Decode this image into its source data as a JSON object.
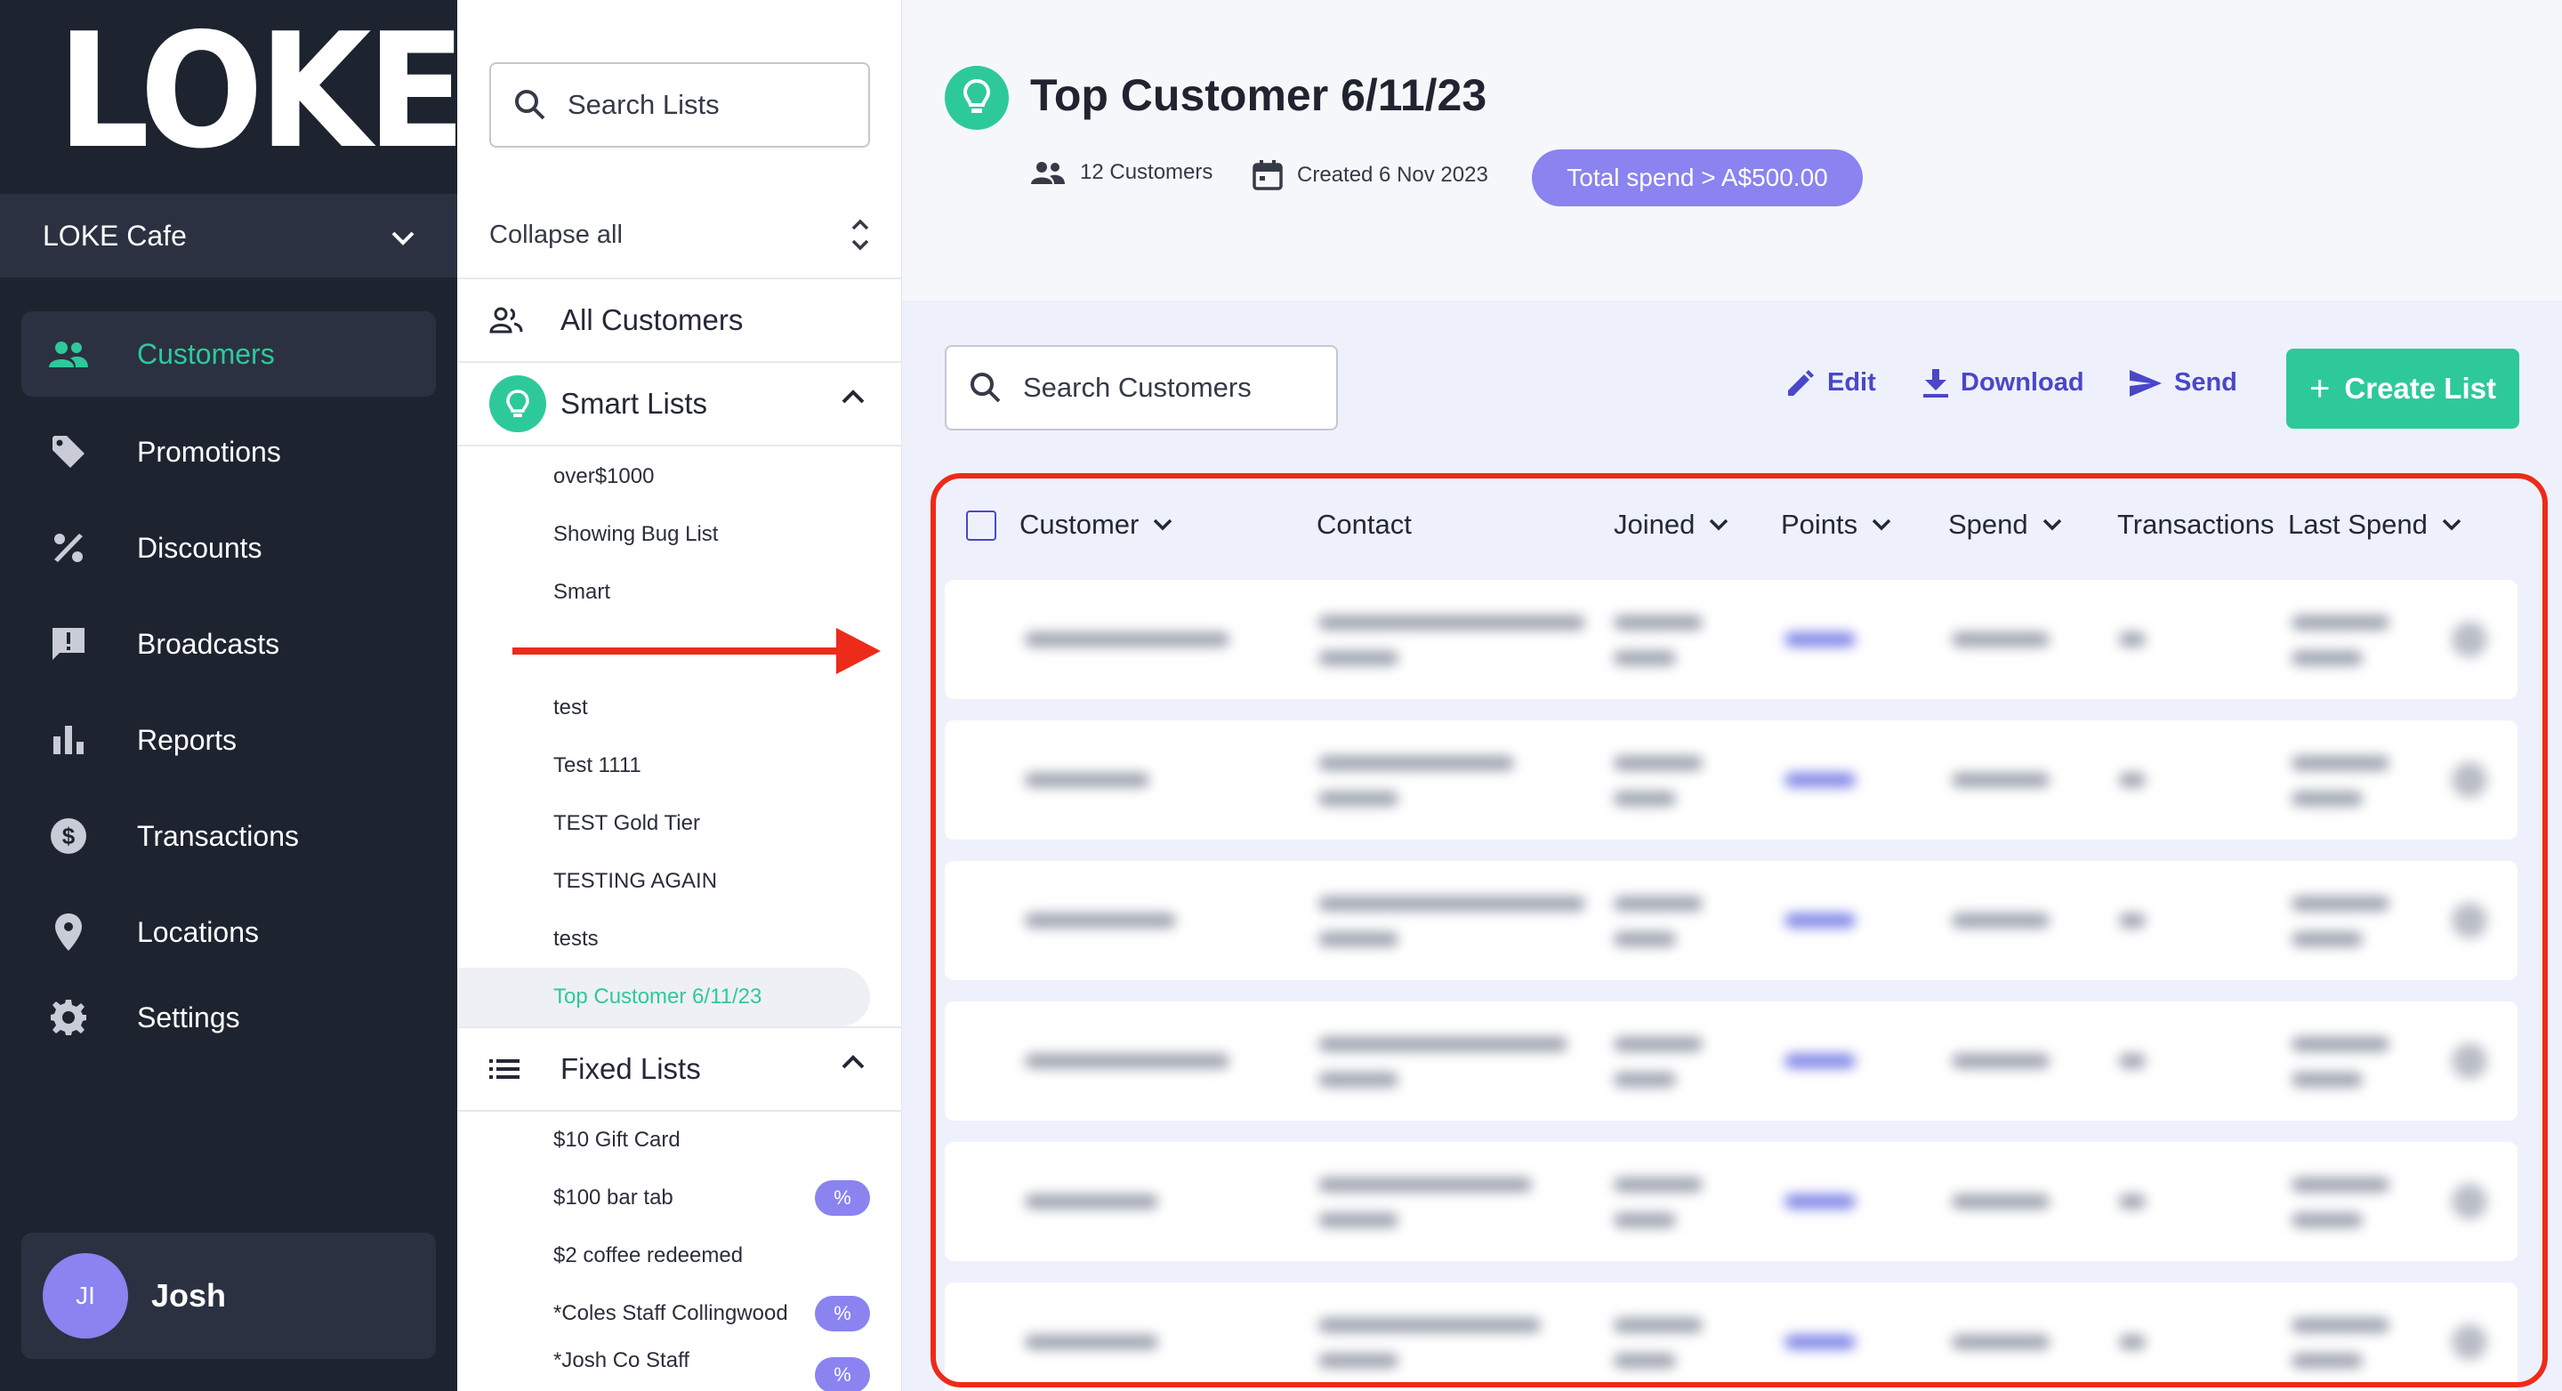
{
  "brand": {
    "logo": "LOKE",
    "venue": "LOKE Cafe"
  },
  "nav": {
    "items": [
      {
        "label": "Customers",
        "icon": "people-icon"
      },
      {
        "label": "Promotions",
        "icon": "tag-icon"
      },
      {
        "label": "Discounts",
        "icon": "percent-icon"
      },
      {
        "label": "Broadcasts",
        "icon": "message-alert-icon"
      },
      {
        "label": "Reports",
        "icon": "bar-chart-icon"
      },
      {
        "label": "Transactions",
        "icon": "dollar-circle-icon"
      },
      {
        "label": "Locations",
        "icon": "location-pin-icon"
      },
      {
        "label": "Settings",
        "icon": "gear-icon"
      }
    ],
    "user": {
      "initials": "JI",
      "name": "Josh"
    }
  },
  "lists": {
    "search_placeholder": "Search Lists",
    "collapse_label": "Collapse all",
    "all_customers": "All Customers",
    "smart_lists_label": "Smart Lists",
    "smart_lists": [
      "over$1000",
      "Showing Bug List",
      "Smart",
      "",
      "test",
      "Test 1111",
      "TEST Gold Tier",
      "TESTING AGAIN",
      "tests",
      "Top Customer 6/11/23"
    ],
    "fixed_lists_label": "Fixed Lists",
    "fixed_lists": [
      "$10 Gift Card",
      "$100 bar tab",
      "$2 coffee redeemed",
      "*Coles Staff Collingwood",
      "*Josh Co Staff"
    ],
    "fixed_badge": "%"
  },
  "header": {
    "title": "Top Customer 6/11/23",
    "customers_count": "12 Customers",
    "created": "Created 6 Nov 2023",
    "filter_pill": "Total spend > A$500.00"
  },
  "toolbar": {
    "search_placeholder": "Search Customers",
    "edit": "Edit",
    "download": "Download",
    "send": "Send",
    "create": "Create List",
    "create_plus": "+"
  },
  "table": {
    "columns": [
      "Customer",
      "Contact",
      "Joined",
      "Points",
      "Spend",
      "Transactions",
      "Last Spend"
    ]
  },
  "colors": {
    "accent_green": "#2ec99a",
    "accent_purple": "#8a83f0",
    "link_blue": "#4a47c9",
    "nav_bg": "#1e2330",
    "highlight_red": "#ee2a1a"
  }
}
